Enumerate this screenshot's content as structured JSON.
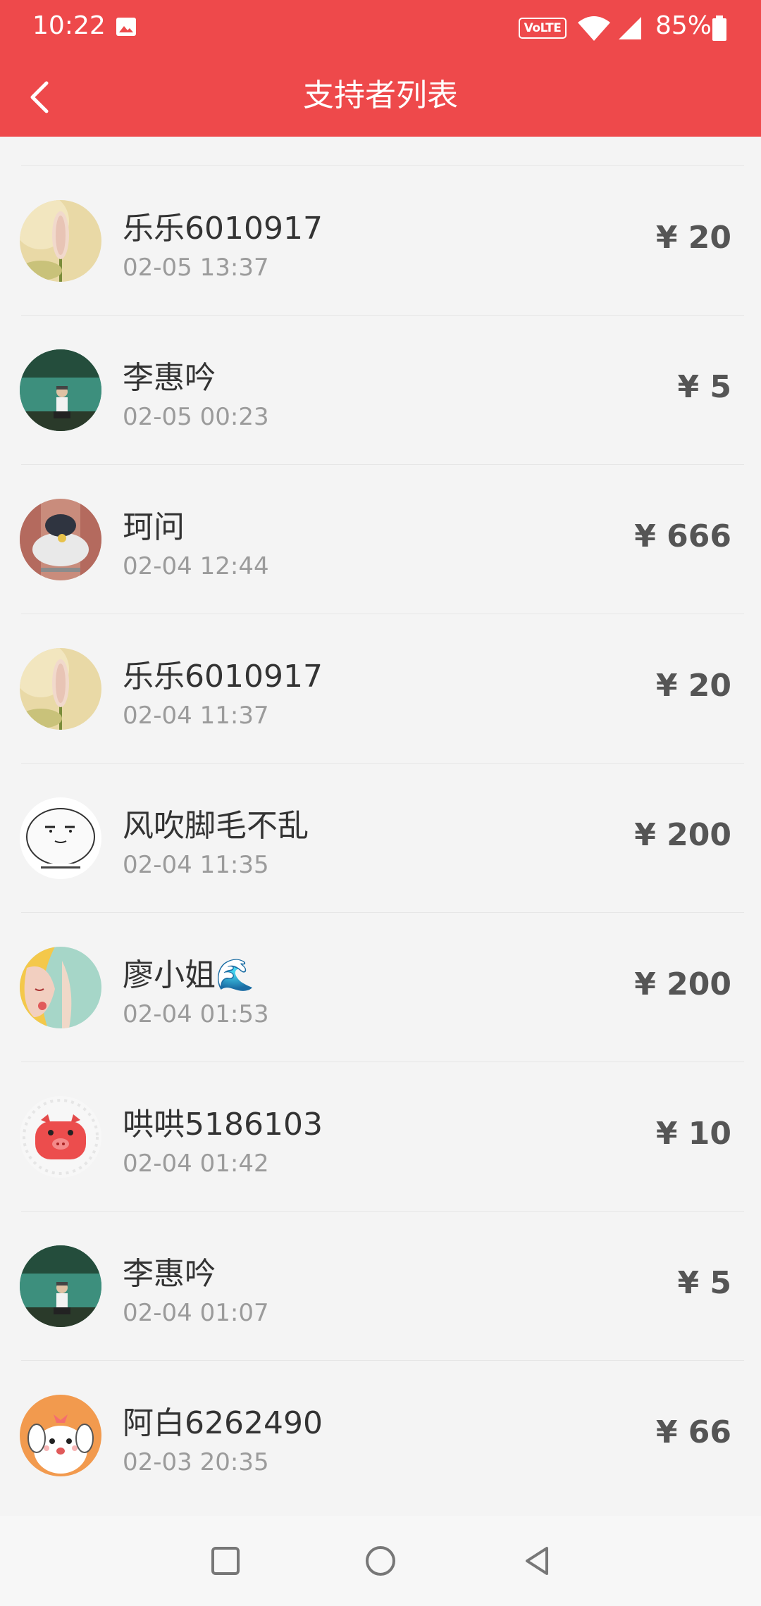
{
  "status_bar": {
    "time": "10:22",
    "volte": "VoLTE",
    "battery": "85%"
  },
  "header": {
    "title": "支持者列表"
  },
  "supporters": [
    {
      "name": "乐乐6010917",
      "time": "02-05 13:37",
      "amount": "¥ 20",
      "avatar": "lupine-flower"
    },
    {
      "name": "李惠吟",
      "time": "02-05 00:23",
      "amount": "¥ 5",
      "avatar": "person-lake"
    },
    {
      "name": "珂问",
      "time": "02-04 12:44",
      "amount": "¥ 666",
      "avatar": "cat-smoke"
    },
    {
      "name": "乐乐6010917",
      "time": "02-04 11:37",
      "amount": "¥ 20",
      "avatar": "lupine-flower"
    },
    {
      "name": "风吹脚毛不乱",
      "time": "02-04 11:35",
      "amount": "¥ 200",
      "avatar": "meme-face"
    },
    {
      "name": "廖小姐🌊",
      "time": "02-04 01:53",
      "amount": "¥ 200",
      "avatar": "girl-illustration"
    },
    {
      "name": "哄哄5186103",
      "time": "02-04 01:42",
      "amount": "¥ 10",
      "avatar": "pig"
    },
    {
      "name": "李惠吟",
      "time": "02-04 01:07",
      "amount": "¥ 5",
      "avatar": "person-lake"
    },
    {
      "name": "阿白6262490",
      "time": "02-03 20:35",
      "amount": "¥ 66",
      "avatar": "puppy"
    }
  ],
  "colors": {
    "header_bg": "#ee494b",
    "page_bg": "#f4f4f4"
  }
}
